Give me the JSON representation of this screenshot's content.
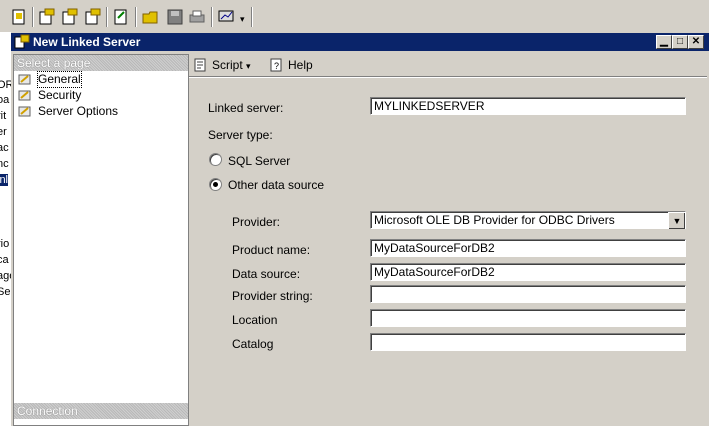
{
  "dialog": {
    "title": "New Linked Server"
  },
  "page_panel": {
    "header": "Select a page",
    "items": [
      {
        "label": "General",
        "selected": true
      },
      {
        "label": "Security",
        "selected": false
      },
      {
        "label": "Server Options",
        "selected": false
      }
    ],
    "footer": "Connection"
  },
  "toolbar": {
    "script_label": "Script",
    "help_label": "Help"
  },
  "form": {
    "linked_server_label": "Linked server:",
    "linked_server_value": "MYLINKEDSERVER",
    "server_type_label": "Server type:",
    "sql_server_label": "SQL Server",
    "other_source_label": "Other data source",
    "server_type_selected": "Other data source",
    "provider_label": "Provider:",
    "provider_value": "Microsoft OLE DB Provider for ODBC Drivers",
    "product_name_label": "Product name:",
    "product_name_value": "MyDataSourceForDB2",
    "data_source_label": "Data source:",
    "data_source_value": "MyDataSourceForDB2",
    "provider_string_label": "Provider string:",
    "provider_string_value": "",
    "location_label": "Location",
    "location_value": "",
    "catalog_label": "Catalog",
    "catalog_value": ""
  },
  "left_strip_fragments": [
    "OR",
    "oa",
    "rit",
    "er",
    "ac",
    "nc",
    "inl",
    "rio",
    "ca",
    "age",
    "Se"
  ]
}
